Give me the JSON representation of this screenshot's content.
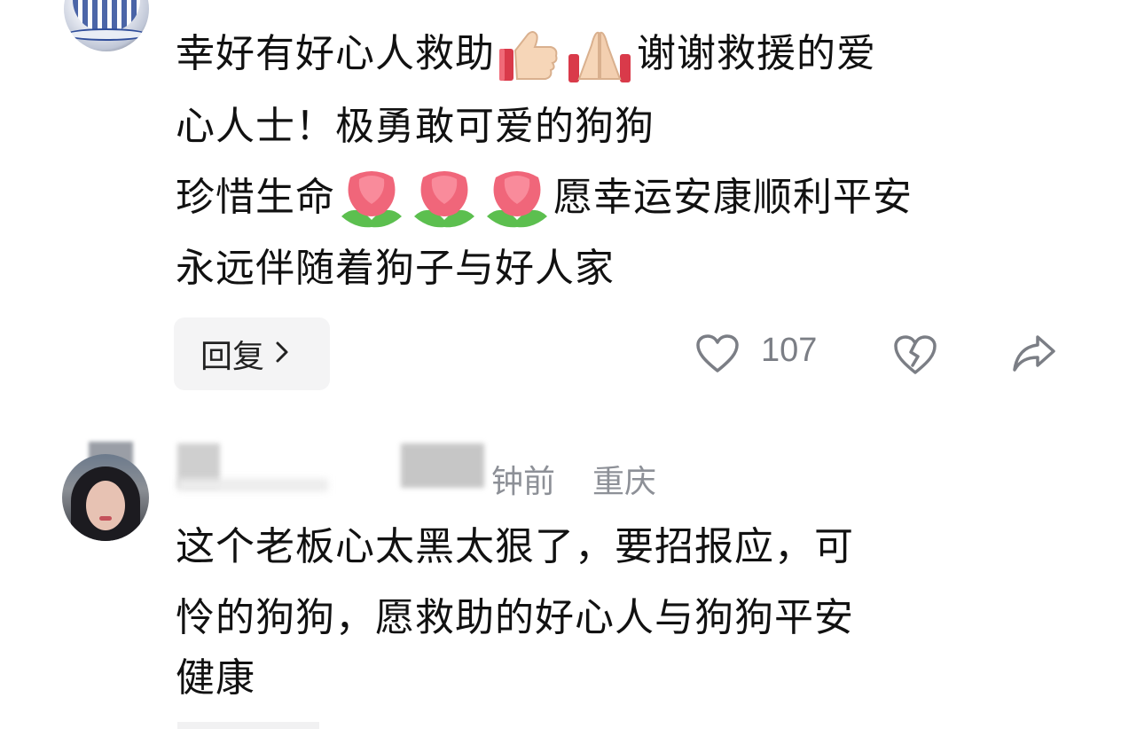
{
  "comments": [
    {
      "avatar": "avatar-porcelain-cup",
      "lines": [
        {
          "seg1": "幸好有好心人救助",
          "emojis": [
            "thumbs-up-emoji",
            "praying-hands-emoji"
          ],
          "seg2": "谢谢救援的爱"
        },
        {
          "text": "心人士！极勇敢可爱的狗狗"
        },
        {
          "seg1": "珍惜生命",
          "emojis": [
            "tulip-emoji",
            "tulip-emoji",
            "tulip-emoji"
          ],
          "seg2": "愿幸运安康顺利平安"
        },
        {
          "text": "永远伴随着狗子与好人家"
        }
      ],
      "reply_label": "回复",
      "like_count": "107"
    },
    {
      "avatar": "avatar-woman",
      "time": "钟前",
      "location": "重庆",
      "lines": [
        {
          "text": "这个老板心太黑太狠了，要招报应，可"
        },
        {
          "text": "怜的狗狗，愿救助的好心人与狗狗平安"
        },
        {
          "text": "健康"
        }
      ]
    }
  ],
  "icons": {
    "like": "heart-outline-icon",
    "dislike": "broken-heart-icon",
    "share": "share-arrow-icon",
    "reply_chevron": "chevron-right-icon"
  },
  "colors": {
    "text": "#111111",
    "meta": "#8d9097",
    "icon": "#7b7e85",
    "pill_bg": "#f4f4f5"
  }
}
